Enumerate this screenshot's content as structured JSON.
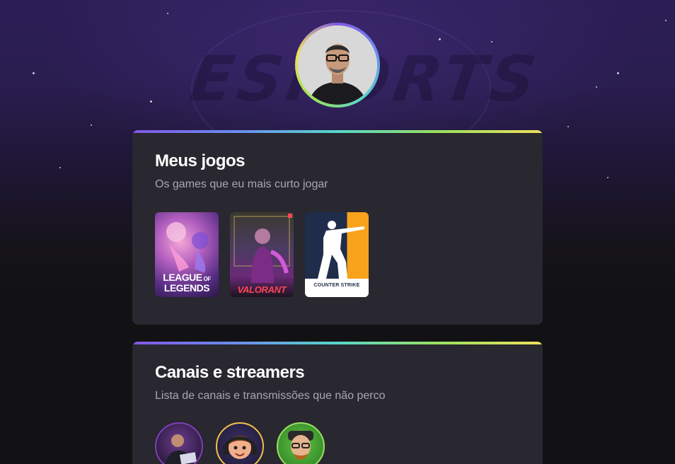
{
  "profile": {
    "avatar_icon": "profile-photo-icon"
  },
  "background": {
    "logo_text": "ESPORTS"
  },
  "games_card": {
    "title": "Meus jogos",
    "subtitle": "Os games que eu mais curto jogar",
    "games": [
      {
        "name": "league-of-legends",
        "line1": "LEAGUE",
        "line1b": "OF",
        "line2": "LEGENDS"
      },
      {
        "name": "valorant",
        "line1": "VALORANT"
      },
      {
        "name": "counter-strike",
        "line1": "COUNTER",
        "line1b": "STRIKE"
      }
    ]
  },
  "channels_card": {
    "title": "Canais e streamers",
    "subtitle": "Lista de canais e transmissões que não perco",
    "channels": [
      {
        "icon": "streamer-avatar-1-icon"
      },
      {
        "icon": "streamer-avatar-2-icon"
      },
      {
        "icon": "streamer-avatar-3-icon"
      }
    ]
  },
  "colors": {
    "accent_purple": "#8257e5",
    "gradient_end_yellow": "#f0e05b",
    "card_bg": "#29272f",
    "page_bg": "#121214"
  }
}
